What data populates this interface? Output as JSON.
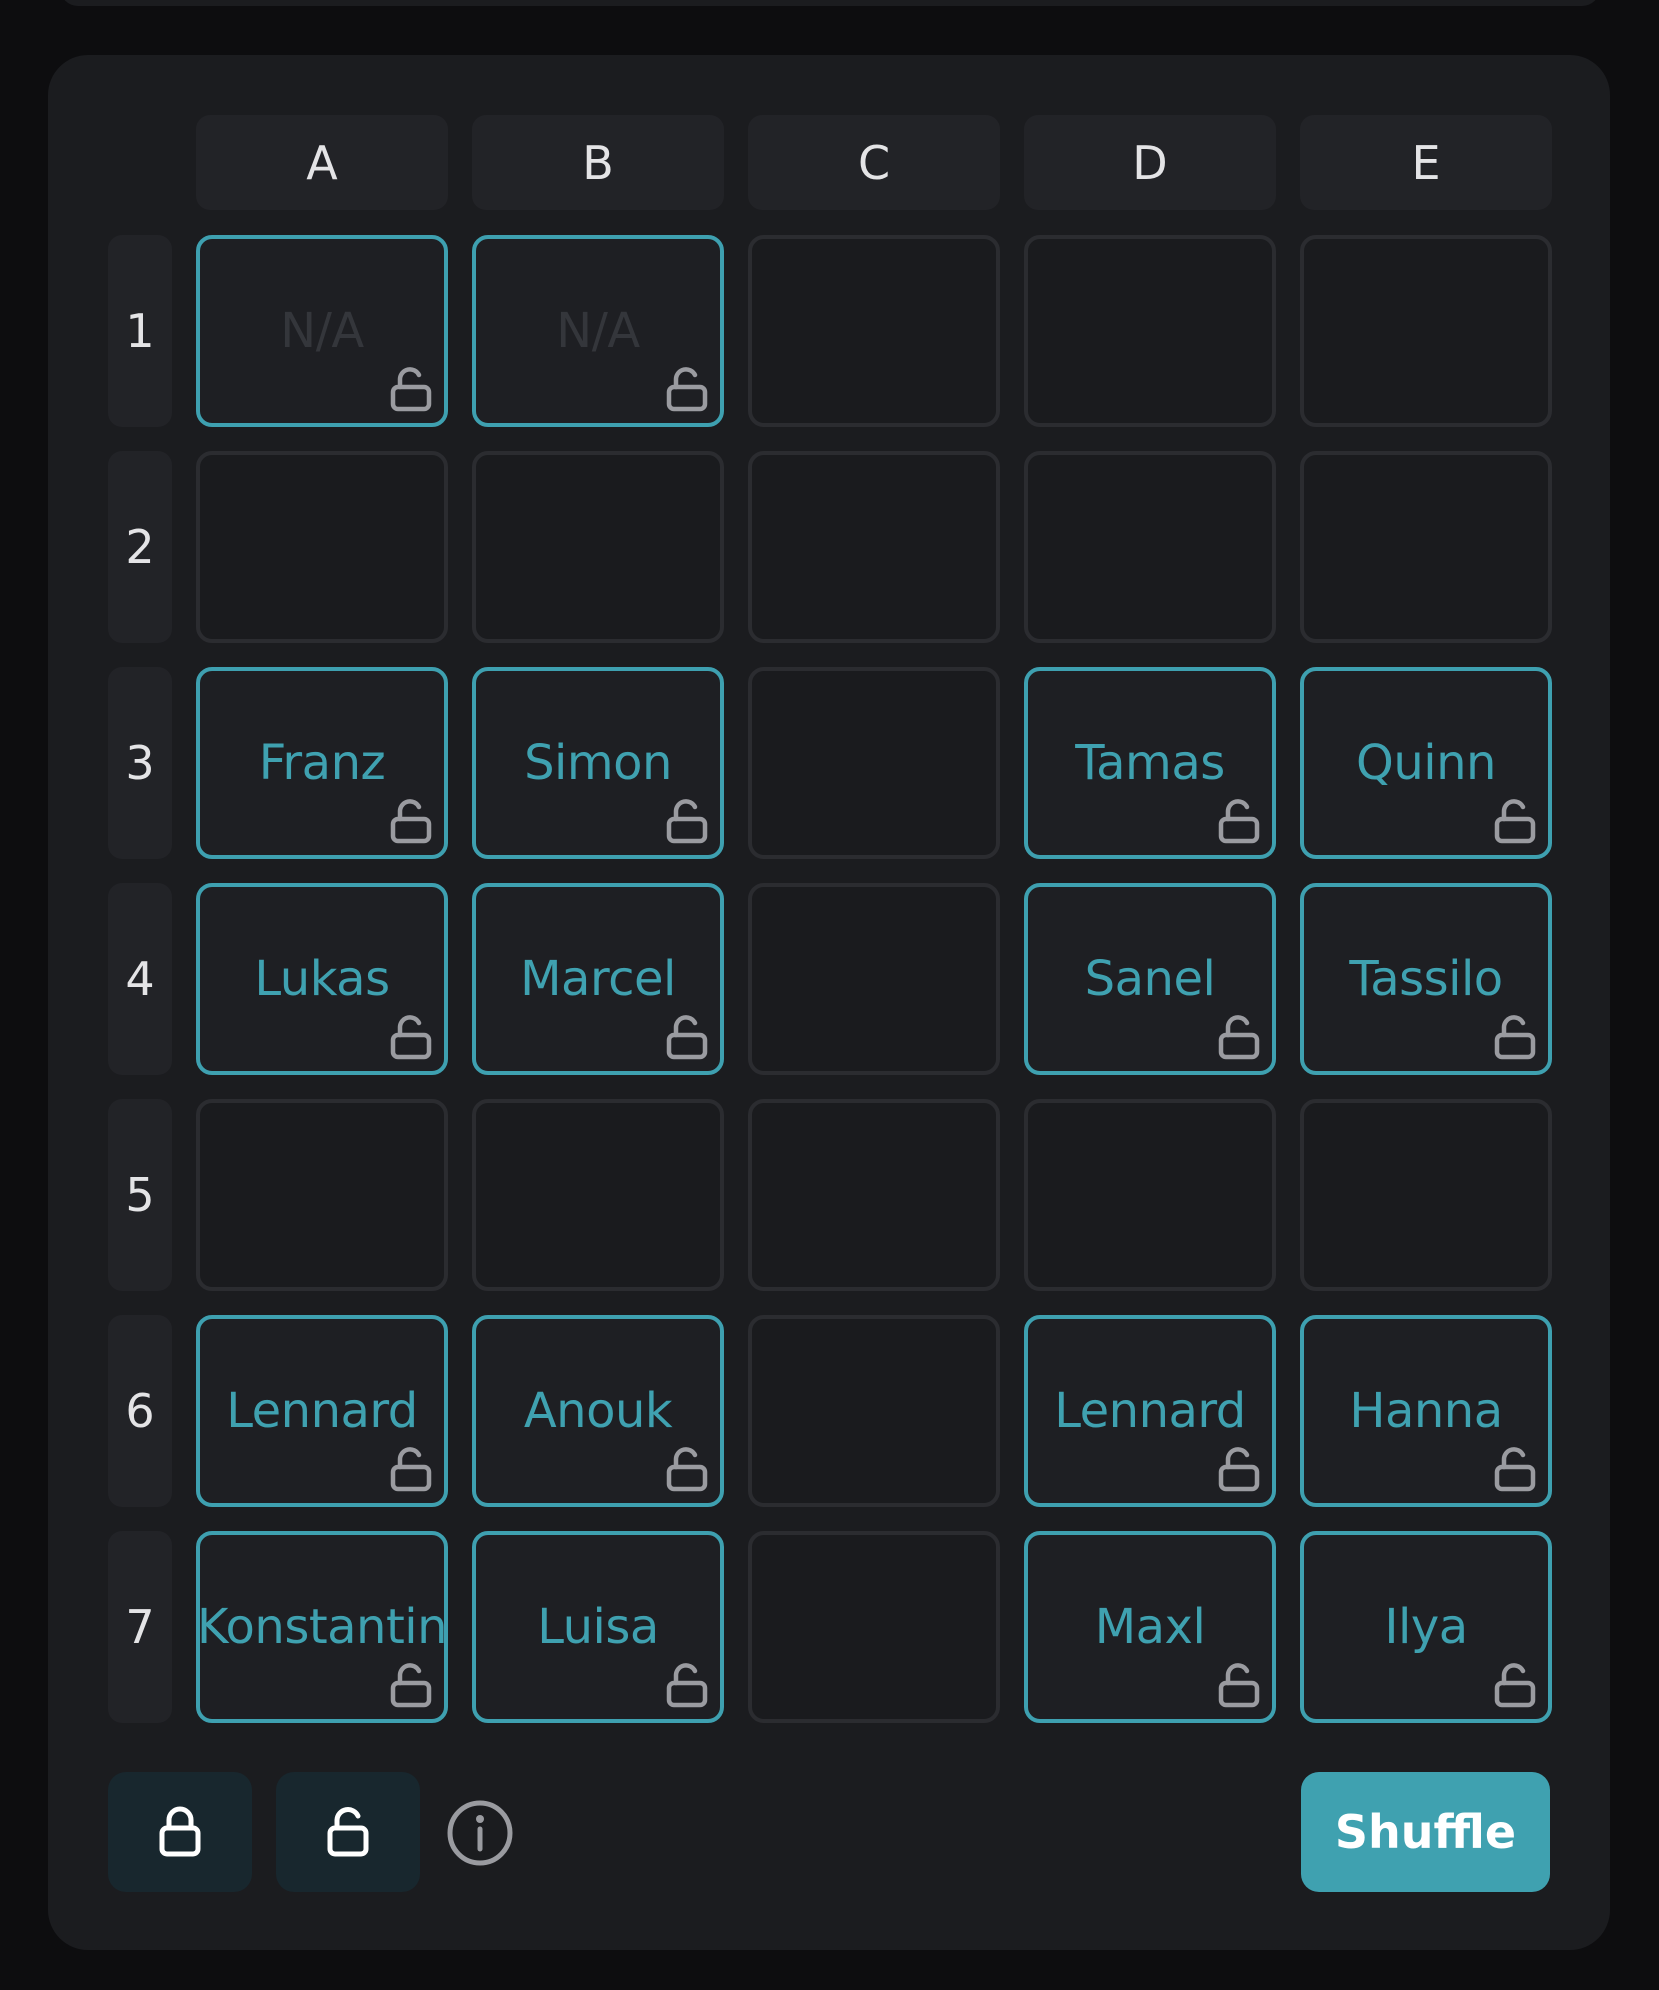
{
  "columns": [
    "A",
    "B",
    "C",
    "D",
    "E"
  ],
  "rows": [
    "1",
    "2",
    "3",
    "4",
    "5",
    "6",
    "7"
  ],
  "placeholder_text": "N/A",
  "grid": [
    [
      "N/A",
      "N/A",
      "",
      "",
      ""
    ],
    [
      "",
      "",
      "",
      "",
      ""
    ],
    [
      "Franz",
      "Simon",
      "",
      "Tamas",
      "Quinn"
    ],
    [
      "Lukas",
      "Marcel",
      "",
      "Sanel",
      "Tassilo"
    ],
    [
      "",
      "",
      "",
      "",
      ""
    ],
    [
      "Lennard",
      "Anouk",
      "",
      "Lennard",
      "Hanna"
    ],
    [
      "Konstantin",
      "Luisa",
      "",
      "Maxl",
      "Ilya"
    ]
  ],
  "footer": {
    "lock_all_icon": "lock-icon",
    "unlock_all_icon": "unlock-icon",
    "info_icon": "info-icon",
    "shuffle_label": "Shuffle"
  },
  "colors": {
    "accent": "#3fa1b0",
    "background": "#0d0d0f",
    "panel": "#1b1c1f"
  }
}
